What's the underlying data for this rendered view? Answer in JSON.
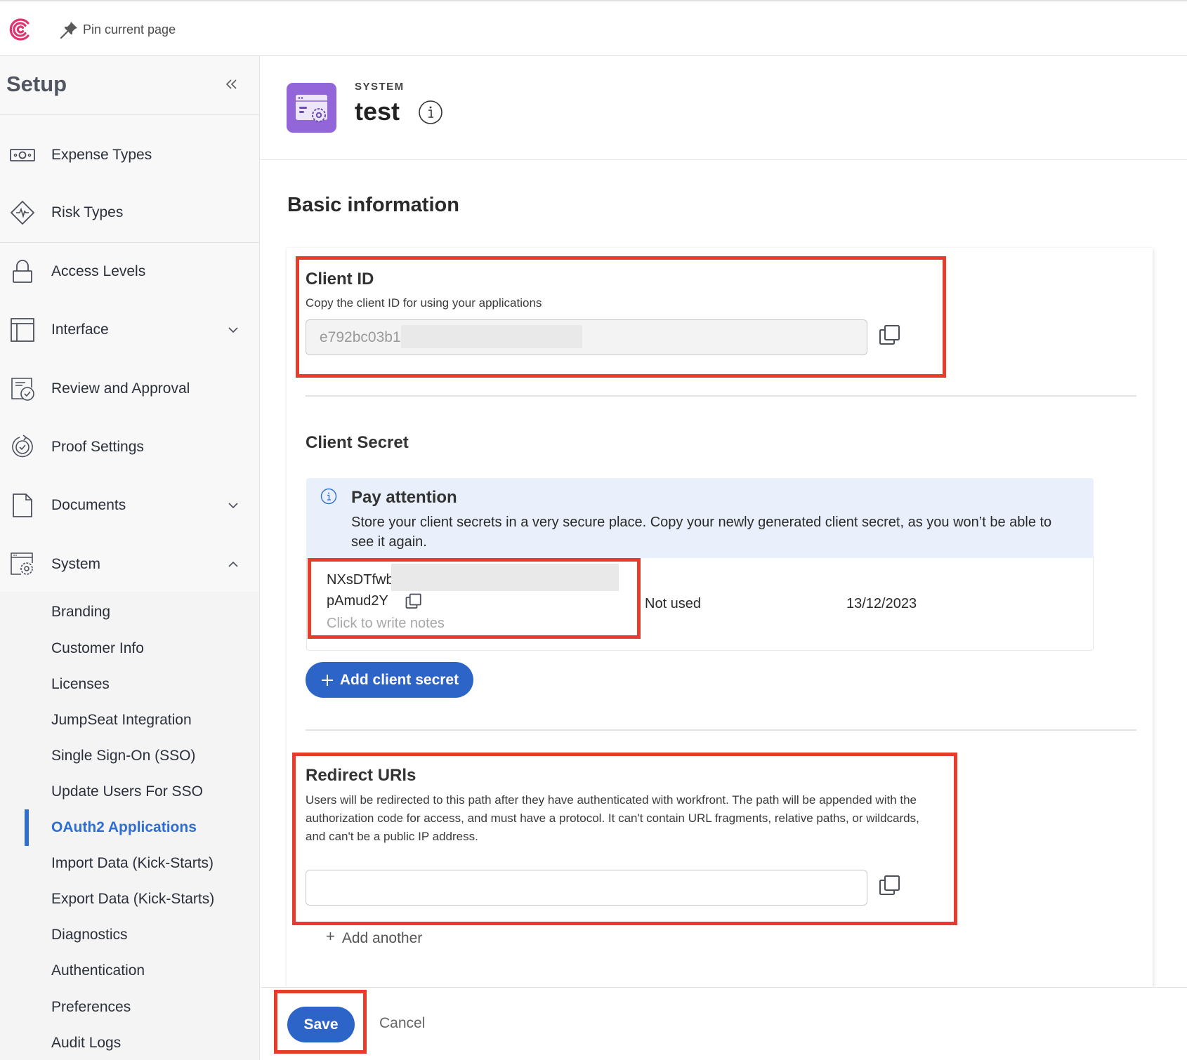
{
  "topbar": {
    "pin_label": "Pin current page",
    "logo_color": "#e0336f"
  },
  "sidebar": {
    "title": "Setup",
    "items": [
      {
        "label": "Expense Types",
        "icon": "money-icon"
      },
      {
        "label": "Risk Types",
        "icon": "risk-icon"
      },
      {
        "label": "Access Levels",
        "icon": "lock-icon"
      },
      {
        "label": "Interface",
        "icon": "layout-icon",
        "expandable": true,
        "expanded": false
      },
      {
        "label": "Review and Approval",
        "icon": "review-icon"
      },
      {
        "label": "Proof Settings",
        "icon": "proof-icon"
      },
      {
        "label": "Documents",
        "icon": "document-icon",
        "expandable": true,
        "expanded": false
      },
      {
        "label": "System",
        "icon": "system-icon",
        "expandable": true,
        "expanded": true
      }
    ],
    "system_items": [
      "Branding",
      "Customer Info",
      "Licenses",
      "JumpSeat Integration",
      "Single Sign-On (SSO)",
      "Update Users For SSO",
      "OAuth2 Applications",
      "Import Data (Kick-Starts)",
      "Export Data (Kick-Starts)",
      "Diagnostics",
      "Authentication",
      "Preferences",
      "Audit Logs"
    ],
    "active_item": "OAuth2 Applications"
  },
  "header": {
    "kicker": "SYSTEM",
    "title": "test"
  },
  "main": {
    "section_title": "Basic information",
    "client_id": {
      "title": "Client ID",
      "description": "Copy the client ID for using your applications",
      "value_visible": "e792bc03b1"
    },
    "client_secret": {
      "title": "Client Secret",
      "alert_title": "Pay attention",
      "alert_body": "Store your client secrets in a very secure place. Copy your newly generated client secret, as you won’t be able to see it again.",
      "secrets": [
        {
          "line1": "NXsDTfwb",
          "line2": "pAmud2Y",
          "notes_placeholder": "Click to write notes",
          "status": "Not used",
          "date": "13/12/2023"
        }
      ],
      "add_button": "Add client secret"
    },
    "redirect_urls": {
      "title": "Redirect URls",
      "description": "Users will be redirected to this path after they have authenticated with workfront. The path will be appended with the authorization code for access, and must have a protocol. It can't contain URL fragments, relative paths, or wildcards, and can't be a public IP address.",
      "value": "",
      "add_another": "Add another"
    }
  },
  "footer": {
    "save": "Save",
    "cancel": "Cancel"
  },
  "colors": {
    "primary": "#2d64c8",
    "active_nav": "#2d6ed3",
    "highlight": "#e53c2c",
    "alert_bg": "#e9f0fb",
    "app_icon": "#9266d9"
  }
}
